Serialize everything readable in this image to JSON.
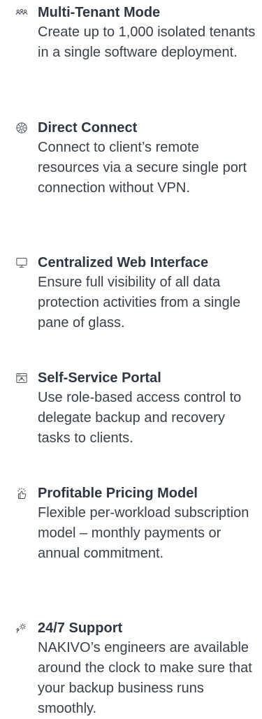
{
  "features": [
    {
      "icon": "users-group-icon",
      "title": "Multi-Tenant Mode",
      "description": "Create up to 1,000 isolated tenants in a single software deployment."
    },
    {
      "icon": "network-globe-icon",
      "title": "Direct Connect",
      "description": "Connect to client’s remote resources via a secure single port connection without VPN."
    },
    {
      "icon": "monitor-icon",
      "title": "Centralized Web Interface",
      "description": "Ensure full visibility of all data protection activities from a single pane of glass."
    },
    {
      "icon": "portal-window-icon",
      "title": "Self-Service Portal",
      "description": "Use role-based access control to delegate backup and recovery tasks to clients."
    },
    {
      "icon": "thumbs-up-sparkle-icon",
      "title": "Profitable Pricing Model",
      "description": "Flexible per-workload subscription model – monthly payments or annual commitment."
    },
    {
      "icon": "support-headset-icon",
      "title": "24/7 Support",
      "description": "NAKIVO’s engineers are available around the clock to make sure that your backup business runs smoothly."
    }
  ]
}
